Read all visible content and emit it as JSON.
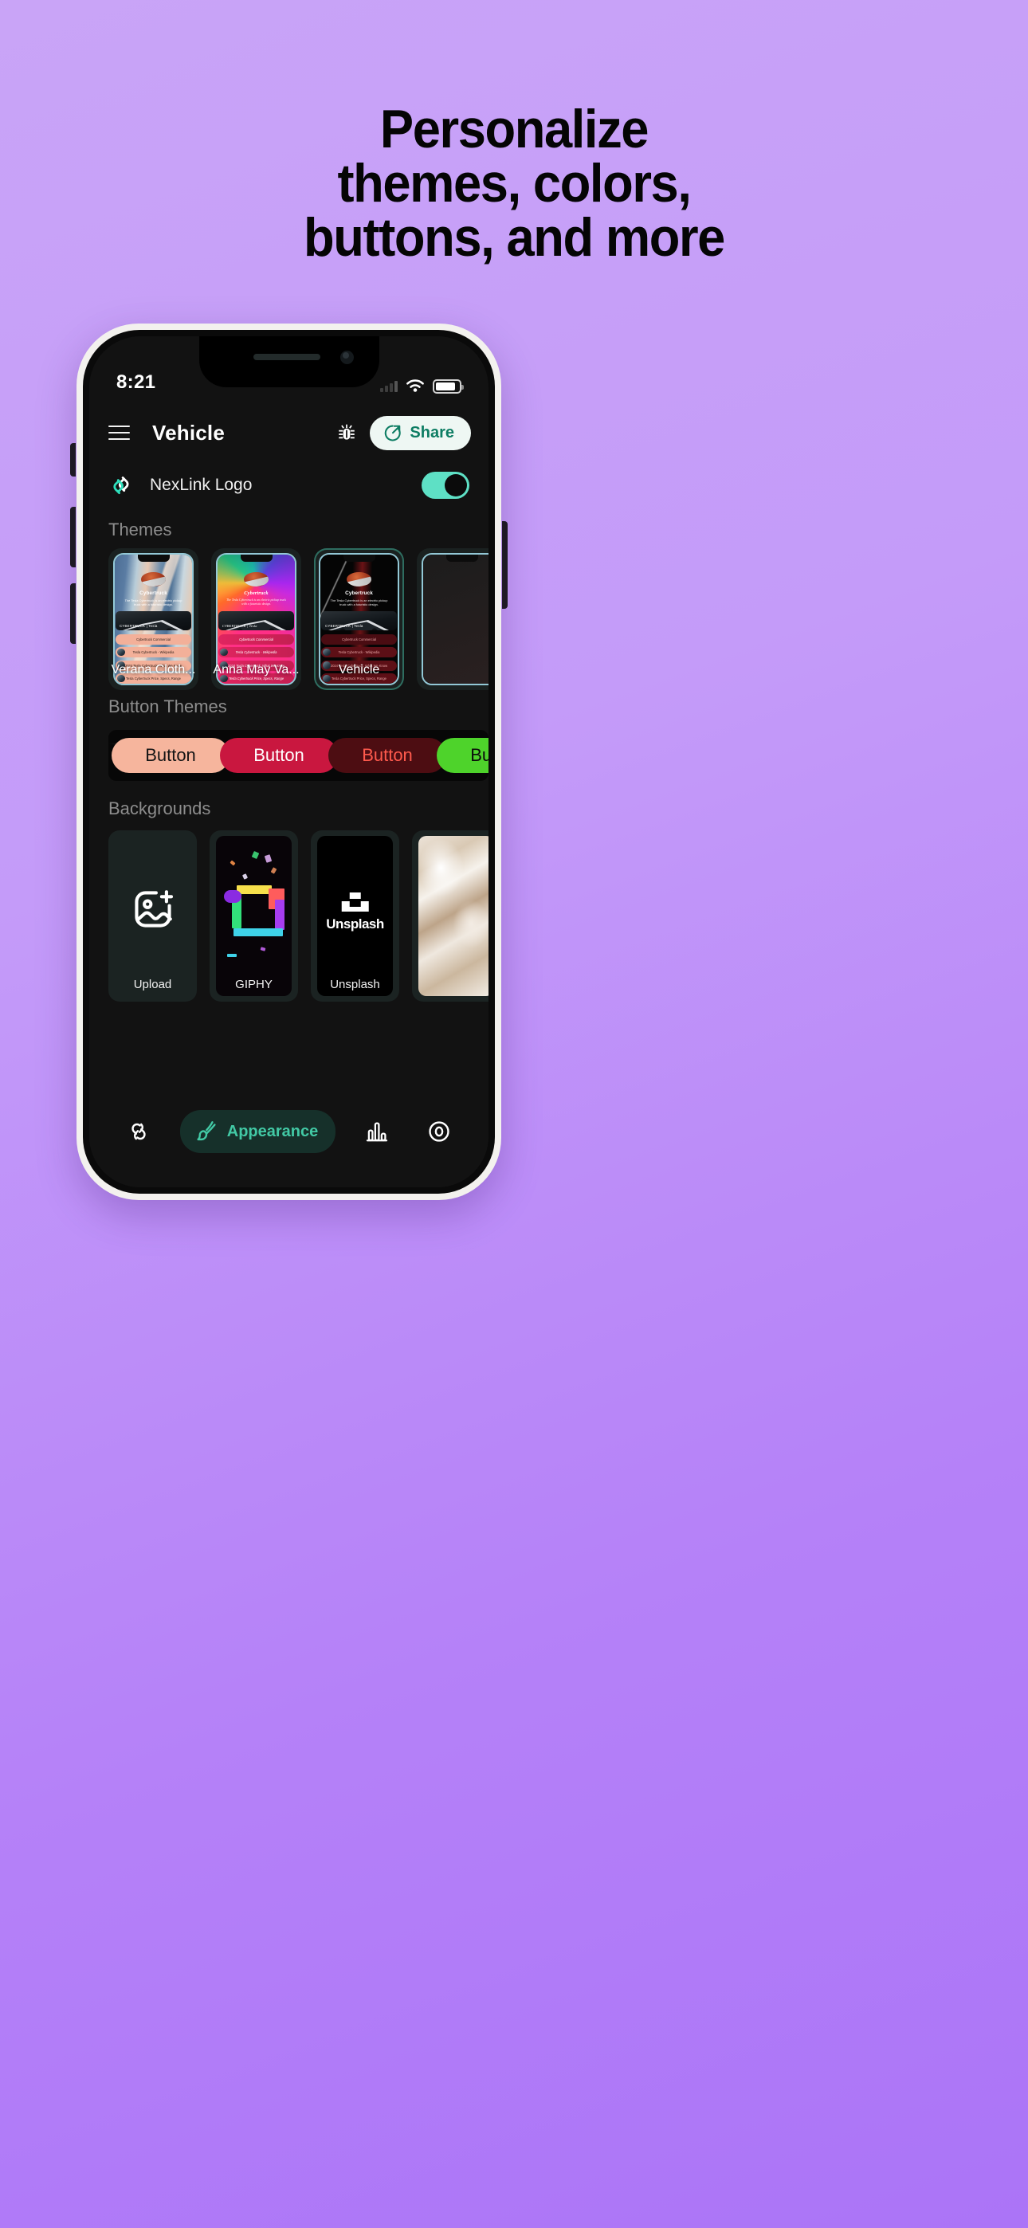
{
  "promo": {
    "headline_lines": [
      "Personalize",
      "themes, colors,",
      "buttons, and more"
    ]
  },
  "phone": {
    "status_bar": {
      "time": "8:21",
      "wifi_icon": "wifi-icon",
      "battery_icon": "battery-icon",
      "signal_icon": "cellular-signal-icon"
    },
    "header": {
      "menu_icon": "hamburger-menu-icon",
      "title": "Vehicle",
      "bug_icon": "bug-icon",
      "share_label": "Share",
      "share_icon": "share-arrow-icon"
    },
    "logo_row": {
      "icon": "chain-link-icon",
      "label": "NexLink Logo",
      "toggle_state": "on"
    },
    "sections": {
      "themes_title": "Themes",
      "button_themes_title": "Button Themes",
      "backgrounds_title": "Backgrounds"
    },
    "themes": [
      {
        "label": "Verana Cloth...",
        "selected": false,
        "preview": {
          "title": "Cybertruck",
          "description": "The Tesla Cybertruck is an electric pickup truck with a futuristic design.",
          "hero_caption": "CYBERTRUCK | Tesla",
          "links": [
            "Cybertruck Commercial",
            "Tesla Cybertruck - Wikipedia",
            "2024 Tesla Cybertruck: What We Know",
            "Tesla Cybertruck Price, Specs, Range"
          ]
        }
      },
      {
        "label": "Anna May Va...",
        "selected": false,
        "preview": {
          "title": "Cybertruck",
          "description": "The Tesla Cybertruck is an electric pickup truck with a futuristic design.",
          "hero_caption": "CYBERTRUCK | Tesla",
          "links": [
            "Cybertruck Commercial",
            "Tesla Cybertruck - Wikipedia",
            "2024 Tesla Cybertruck: What We Know",
            "Tesla Cybertruck Price, Specs, Range"
          ]
        }
      },
      {
        "label": "Vehicle",
        "selected": true,
        "preview": {
          "title": "Cybertruck",
          "description": "The Tesla Cybertruck is an electric pickup truck with a futuristic design.",
          "hero_caption": "CYBERTRUCK | Tesla",
          "links": [
            "Cybertruck Commercial",
            "Tesla Cybertruck - Wikipedia",
            "2024 Tesla Cybertruck: What We Know",
            "Tesla Cybertruck Price, Specs, Range"
          ]
        }
      }
    ],
    "button_themes": [
      {
        "label": "Button",
        "fill": "#f6b59d",
        "text": "#151515"
      },
      {
        "label": "Button",
        "fill": "#c9173f",
        "text": "#ffffff"
      },
      {
        "label": "Button",
        "fill": "#4d0d12",
        "text": "#ff5a4d"
      },
      {
        "label": "Button",
        "fill": "#4ed32b",
        "text": "#0b0b0b"
      }
    ],
    "backgrounds": [
      {
        "label": "Upload",
        "icon": "image-plus-icon"
      },
      {
        "label": "GIPHY",
        "icon": "giphy-logo"
      },
      {
        "label": "Unsplash",
        "icon": "unsplash-logo"
      },
      {
        "label": "",
        "icon": "marble-photo"
      }
    ],
    "bottom_nav": [
      {
        "label": "",
        "icon": "links-icon",
        "active": false
      },
      {
        "label": "Appearance",
        "icon": "paintbrush-icon",
        "active": true
      },
      {
        "label": "",
        "icon": "bar-chart-icon",
        "active": false
      },
      {
        "label": "",
        "icon": "eye-preview-icon",
        "active": false
      }
    ]
  },
  "colors": {
    "accent_teal": "#42c9a5",
    "toggle_on": "#5ee0c5",
    "bg_purple_top": "#c9a4f7",
    "bg_purple_bottom": "#ab74f7",
    "app_background": "#121212"
  }
}
